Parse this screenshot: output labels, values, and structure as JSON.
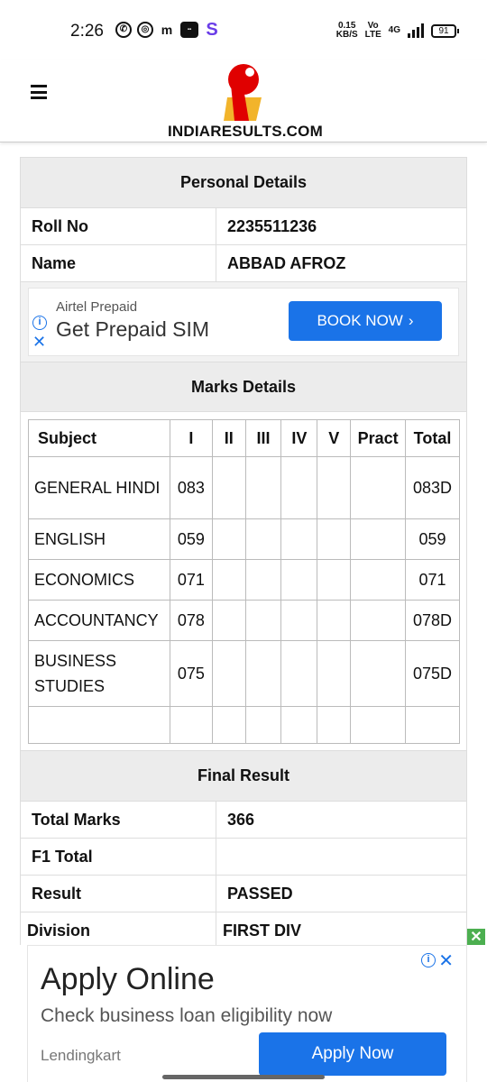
{
  "status_bar": {
    "time": "2:26",
    "net_speed": "0.15",
    "net_unit": "KB/S",
    "carrier": "Vo LTE",
    "network": "4G",
    "battery": "91"
  },
  "header": {
    "logo_text": "INDIARESULTS.COM",
    "logo_color": "#e00000",
    "logo_accent": "#f2b42b"
  },
  "personal": {
    "heading": "Personal Details",
    "roll_label": "Roll No",
    "roll_value": "2235511236",
    "name_label": "Name",
    "name_value": "ABBAD AFROZ"
  },
  "inline_ad": {
    "advertiser": "Airtel Prepaid",
    "headline": "Get Prepaid SIM",
    "button": "BOOK NOW",
    "info_icon": "i",
    "close_icon": "✕"
  },
  "marks": {
    "heading": "Marks Details",
    "columns": [
      "Subject",
      "I",
      "II",
      "III",
      "IV",
      "V",
      "Pract",
      "Total"
    ],
    "rows": [
      {
        "subject": " GENERAL HINDI",
        "c1": "083",
        "total": "083D"
      },
      {
        "subject": " ENGLISH",
        "c1": "059",
        "total": "059"
      },
      {
        "subject": " ECONOMICS",
        "c1": "071",
        "total": "071"
      },
      {
        "subject": " ACCOUNTANCY",
        "c1": "078",
        "total": "078D"
      },
      {
        "subject": " BUSINESS STUDIES",
        "c1": "075",
        "total": "075D"
      }
    ]
  },
  "final": {
    "heading": "Final Result",
    "total_label": "Total Marks",
    "total_value": "366",
    "f1_label": "F1 Total",
    "f1_value": "",
    "result_label": "Result",
    "result_value": "PASSED",
    "division_label": "Division",
    "division_value": "FIRST DIV"
  },
  "bottom_ad": {
    "title": "Apply Online",
    "subtitle": "Check business loan eligibility now",
    "brand": "Lendingkart",
    "button": "Apply Now",
    "close_icon": "✕",
    "info_icon": "i",
    "green_close": "✕"
  },
  "colors": {
    "button_blue": "#1a73e8",
    "close_green": "#4caf50"
  }
}
